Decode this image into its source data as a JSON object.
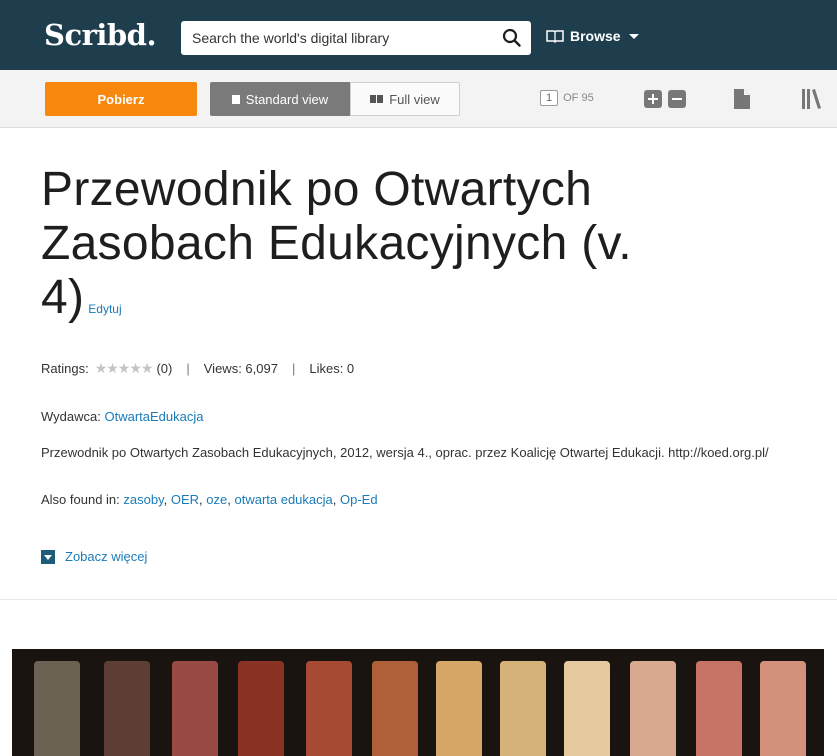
{
  "header": {
    "logo": "Scribd.",
    "search": {
      "placeholder": "Search the world's digital library",
      "value": ""
    },
    "browse_label": "Browse"
  },
  "toolbar": {
    "download_label": "Pobierz",
    "standard_view_label": "Standard view",
    "full_view_label": "Full view",
    "current_page": "1",
    "of_pages": "OF 95"
  },
  "document": {
    "title": "Przewodnik po Otwartych Zasobach Edukacyjnych (v. 4)",
    "edit_label": "Edytuj",
    "ratings_label": "Ratings:",
    "ratings_count": "(0)",
    "rating_stars": 0,
    "views": "Views: 6,097",
    "likes": "Likes: 0",
    "publisher_label": "Wydawca:",
    "publisher": "OtwartaEdukacja",
    "description": "Przewodnik po Otwartych Zasobach Edukacyjnych, 2012, wersja 4., oprac. przez Koalicję Otwartej Edukacji. http://koed.org.pl/",
    "also_found_label": "Also found in:",
    "tags": [
      "zasoby",
      "OER",
      "oze",
      "otwarta edukacja",
      "Op-Ed"
    ],
    "see_more_label": "Zobacz więcej"
  },
  "colors": {
    "header_bg": "#1e3d4d",
    "accent_orange": "#f7870d",
    "link_blue": "#1a7bb9"
  },
  "icons": [
    "search-icon",
    "book-icon",
    "chevron-down-icon",
    "zoom-in-icon",
    "zoom-out-icon",
    "page-icon",
    "library-icon"
  ]
}
